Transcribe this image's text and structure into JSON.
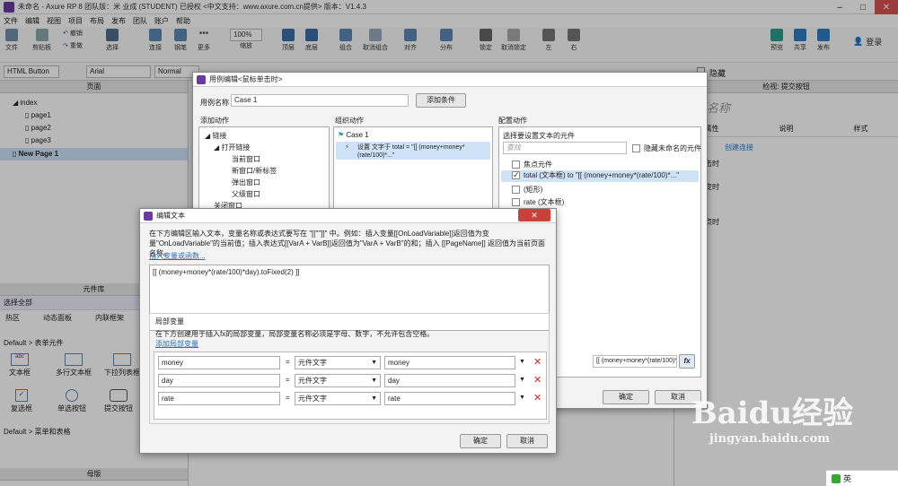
{
  "window": {
    "title": "未命名 - Axure RP 8 团队版：米 业成 (STUDENT) 已授权   <中文支持：www.axure.com.cn提供> 版本：V1.4.3"
  },
  "menu": [
    "文件",
    "编辑",
    "视图",
    "项目",
    "布局",
    "发布",
    "团队",
    "账户",
    "帮助"
  ],
  "toolbar": {
    "items": [
      {
        "label": "文件"
      },
      {
        "label": "剪贴板"
      },
      {
        "label": "撤销"
      },
      {
        "label": "重做"
      },
      {
        "label": "选择"
      },
      {
        "label": "连接"
      },
      {
        "label": "钢笔"
      },
      {
        "label": "更多"
      },
      {
        "label": "缩放"
      },
      {
        "label": "顶层"
      },
      {
        "label": "底层"
      },
      {
        "label": "组合"
      },
      {
        "label": "取消组合"
      },
      {
        "label": "对齐"
      },
      {
        "label": "分布"
      },
      {
        "label": "锁定"
      },
      {
        "label": "取消锁定"
      },
      {
        "label": "左"
      },
      {
        "label": "右"
      },
      {
        "label": "预览"
      },
      {
        "label": "共享"
      },
      {
        "label": "发布"
      }
    ],
    "zoom": "100%",
    "login": "登录"
  },
  "stylebar": {
    "widget_style": "HTML Button",
    "font": "Arial",
    "weight": "Normal",
    "hidden_label": "隐藏"
  },
  "pages_panel": {
    "title": "页面",
    "pages": [
      {
        "label": "index"
      },
      {
        "label": "page1"
      },
      {
        "label": "page2"
      },
      {
        "label": "page3"
      },
      {
        "label": "New Page 1"
      }
    ]
  },
  "library_panel": {
    "title": "元件库",
    "select_all": "选择全部",
    "tabs": [
      "热区",
      "动态面板",
      "内联框架"
    ],
    "section_forms": "Default > 表单元件",
    "widgets": [
      "文本框",
      "多行文本框",
      "下拉列表框",
      "复选框",
      "单选按钮",
      "提交按钮"
    ],
    "section_menus": "Default > 菜单和表格",
    "masters_title": "母版"
  },
  "right_panel": {
    "header": "检视: 提交按钮",
    "name_placeholder": "按钮名称",
    "tabs": [
      "属性",
      "说明",
      "样式"
    ],
    "case_label": "用例",
    "create_link": "创建连接",
    "events": [
      "鼠标单击时",
      "移动时",
      "尺寸改变时",
      "显示时",
      "隐藏时",
      "获取焦点时"
    ]
  },
  "case_dialog": {
    "title": "用例编辑<鼠标单击时>",
    "case_name_label": "用例名称",
    "case_name": "Case 1",
    "add_condition": "添加条件",
    "col_add": "添加动作",
    "col_org": "组织动作",
    "col_cfg": "配置动作",
    "actions": [
      "链接",
      "打开链接",
      "当前窗口",
      "新窗口/新标签",
      "弹出窗口",
      "父级窗口",
      "关闭窗口"
    ],
    "case_item": "Case 1",
    "org_action": "设置 文字于 total = \"[[ (money+money*(rate/100)*...\"",
    "cfg_header": "选择要设置文本的元件",
    "search_placeholder": "查找",
    "hide_unnamed": "隐藏未命名的元件",
    "elements": [
      {
        "label": "焦点元件",
        "checked": false
      },
      {
        "label": "total (文本框) to \"[[ (money+money*(rate/100)*...\"",
        "checked": true
      },
      {
        "label": "(矩形)",
        "checked": false
      },
      {
        "label": "rate (文本框)",
        "checked": false
      }
    ],
    "value_field": "[[ (money+money*(rate/100)*da",
    "fx": "fx",
    "ok": "确定",
    "cancel": "取消"
  },
  "text_dialog": {
    "title": "编辑文本",
    "instructions": "在下方编辑区输入文本，变量名称或表达式要写在 \"[[\"\"]]\" 中。例如：插入变量[[OnLoadVariable]]返回值为变量\"OnLoadVariable\"的当前值；插入表达式[[VarA + VarB]]返回值为\"VarA + VarB\"的和；插入 [[PageName]] 返回值为当前页面名称。",
    "insert_link": "插入变量或函数...",
    "expression": "[[ (money+money*(rate/100)*day).toFixed(2) ]]",
    "local_vars_title": "局部变量",
    "local_vars_hint": "在下方创建用于插入fx的局部变量，局部变量名称必须是字母、数字，不允许包含空格。",
    "add_local": "添加局部变量",
    "variables": [
      {
        "name": "money",
        "type": "元件文字",
        "target": "money"
      },
      {
        "name": "day",
        "type": "元件文字",
        "target": "day"
      },
      {
        "name": "rate",
        "type": "元件文字",
        "target": "rate"
      }
    ],
    "ok": "确定",
    "cancel": "取消"
  },
  "watermark": {
    "main": "Baidu经验",
    "url": "jingyan.baidu.com"
  },
  "taskbar": {
    "ime": "英"
  }
}
